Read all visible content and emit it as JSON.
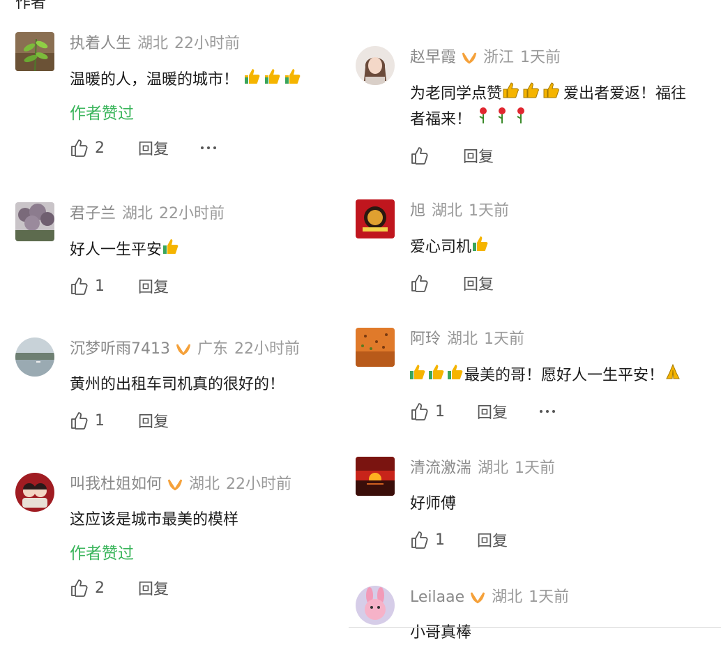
{
  "partial_header": "作者",
  "reply_label": "回复",
  "liked_by_author": "作者赞过",
  "left_comments": [
    {
      "user": "执着人生",
      "verified": false,
      "region": "湖北",
      "time": "22小时前",
      "text": "温暖的人，温暖的城市！",
      "emoji": "thumbs-up-x3",
      "liked_by_author": true,
      "likes": "2",
      "more": true,
      "avatar": "plant-avatar"
    },
    {
      "user": "君子兰",
      "verified": false,
      "region": "湖北",
      "time": "22小时前",
      "text": "好人一生平安",
      "emoji": "thumbs-up",
      "liked_by_author": false,
      "likes": "1",
      "more": false,
      "avatar": "flower-tree-avatar"
    },
    {
      "user": "沉梦听雨7413",
      "verified": true,
      "region": "广东",
      "time": "22小时前",
      "text": "黄州的出租车司机真的很好的！",
      "emoji": "",
      "liked_by_author": false,
      "likes": "1",
      "more": false,
      "avatar": "lake-avatar"
    },
    {
      "user": "叫我杜姐如何",
      "verified": true,
      "region": "湖北",
      "time": "22小时前",
      "text": "这应该是城市最美的模样",
      "emoji": "",
      "liked_by_author": true,
      "likes": "2",
      "more": false,
      "avatar": "cartoon-couple-avatar"
    }
  ],
  "right_comments": [
    {
      "user": "赵早霞",
      "verified": true,
      "region": "浙江",
      "time": "1天前",
      "text_line1": "为老同学点赞",
      "text_line1b": "爱出者爱返！福往",
      "text_line2": "者福来！",
      "likes": "",
      "more": false,
      "avatar": "woman-portrait-avatar"
    },
    {
      "user": "旭",
      "verified": false,
      "region": "湖北",
      "time": "1天前",
      "text": "爱心司机",
      "likes": "",
      "more": false,
      "avatar": "red-emblem-avatar"
    },
    {
      "user": "阿玲",
      "verified": false,
      "region": "湖北",
      "time": "1天前",
      "text": "最美的哥！愿好人一生平安！",
      "likes": "1",
      "more": true,
      "avatar": "autumn-leaves-avatar"
    },
    {
      "user": "清流激湍",
      "verified": false,
      "region": "湖北",
      "time": "1天前",
      "text": "好师傅",
      "likes": "1",
      "more": false,
      "avatar": "sunset-avatar"
    },
    {
      "user": "Leilaae",
      "verified": true,
      "region": "湖北",
      "time": "1天前",
      "text": "小哥真棒",
      "avatar": "pink-bunny-avatar"
    }
  ],
  "colors": {
    "green": "#3ab55b",
    "meta_gray": "#9a9a9a",
    "badge_orange": "#f5a13a",
    "thumb_yellow": "#f5b400"
  }
}
